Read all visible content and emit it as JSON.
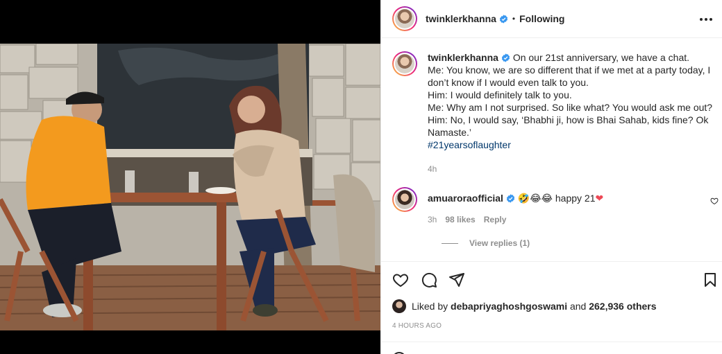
{
  "header": {
    "username": "twinklerkhanna",
    "separator": "•",
    "follow_state": "Following",
    "more_icon": "more-horizontal-icon"
  },
  "caption": {
    "username": "twinklerkhanna",
    "lines": [
      "On our 21st anniversary, we have a chat.",
      "Me: You know, we are so different that if we met at a party today, I don’t know if I would even talk to you.",
      "Him: I would definitely talk to you.",
      "Me: Why am I not surprised. So like what? You would ask me out?",
      "Him: No, I would say, ‘Bhabhi ji, how is Bhai Sahab, kids fine? Ok Namaste.’"
    ],
    "hashtag": "#21yearsoflaughter",
    "time": "4h"
  },
  "comment": {
    "username": "amuaroraofficial",
    "emojis": "🤣😂😂",
    "text": "happy 21",
    "heart": "❤",
    "time": "3h",
    "likes": "98 likes",
    "reply_label": "Reply",
    "view_replies": "View replies (1)"
  },
  "actions": {
    "like_icon": "heart-outline-icon",
    "comment_icon": "comment-bubble-icon",
    "share_icon": "paper-plane-icon",
    "save_icon": "bookmark-icon"
  },
  "likes": {
    "prefix": "Liked by",
    "user": "debapriyaghoshgoswami",
    "connector": "and",
    "others": "262,936 others"
  },
  "post_age": "4 HOURS AGO",
  "colors": {
    "verified": "#3897f0",
    "link": "#00376b",
    "muted": "#8e8e8e",
    "heart": "#ed4956"
  }
}
